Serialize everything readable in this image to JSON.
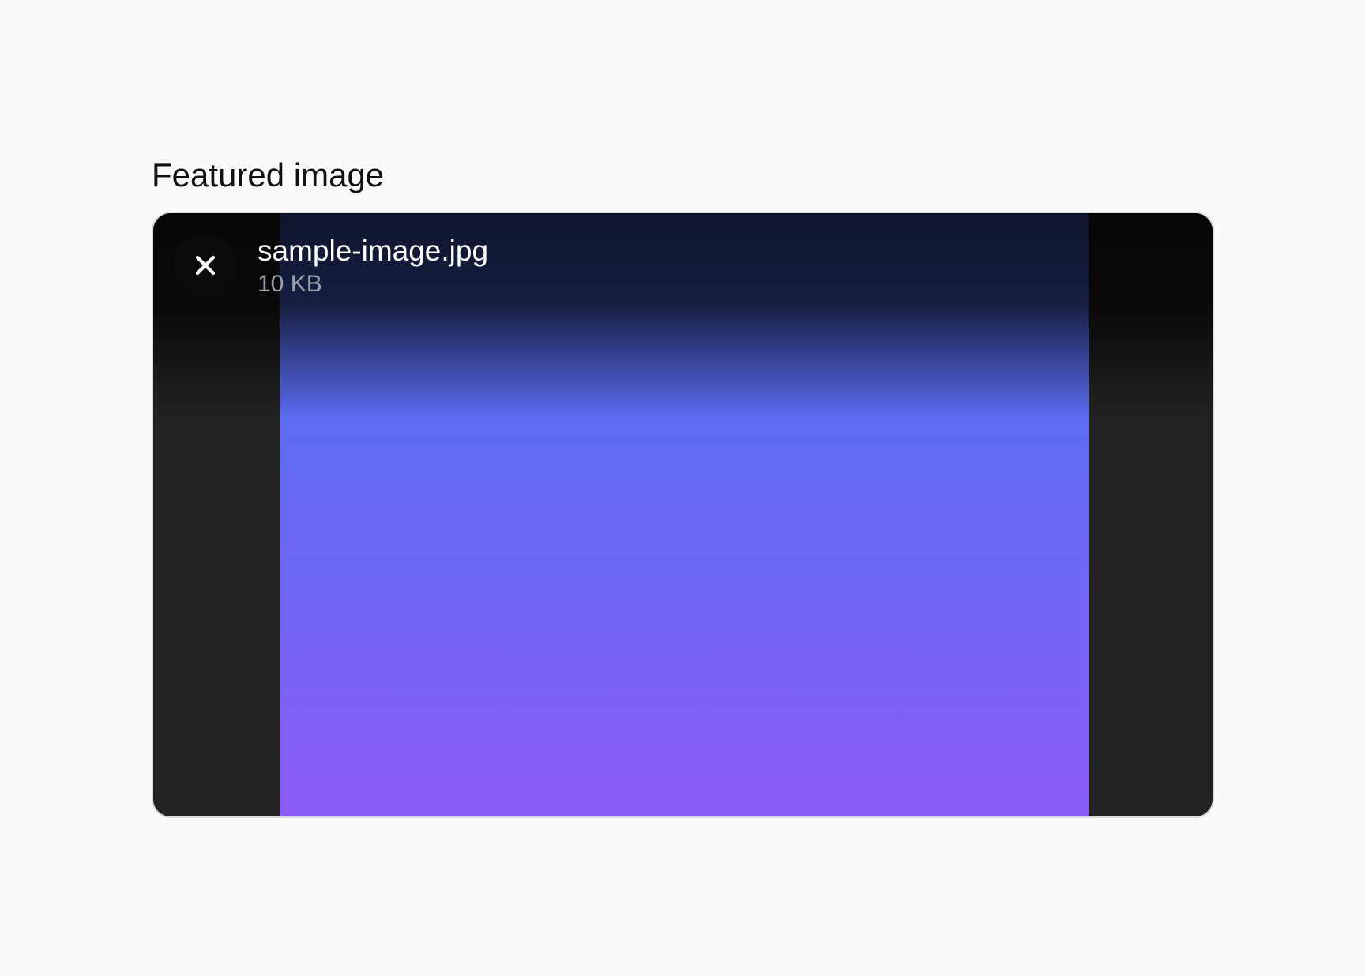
{
  "field": {
    "label": "Featured image"
  },
  "upload": {
    "file_name": "sample-image.jpg",
    "file_size": "10 KB",
    "remove_icon": "close-icon"
  },
  "colors": {
    "page_background": "#fafafa",
    "frame_background": "#222222",
    "image_gradient_top": "#4c71ee",
    "image_gradient_bottom": "#8b5cf6",
    "file_name_text": "#ffffff",
    "file_size_text": "#9aa1ad"
  }
}
